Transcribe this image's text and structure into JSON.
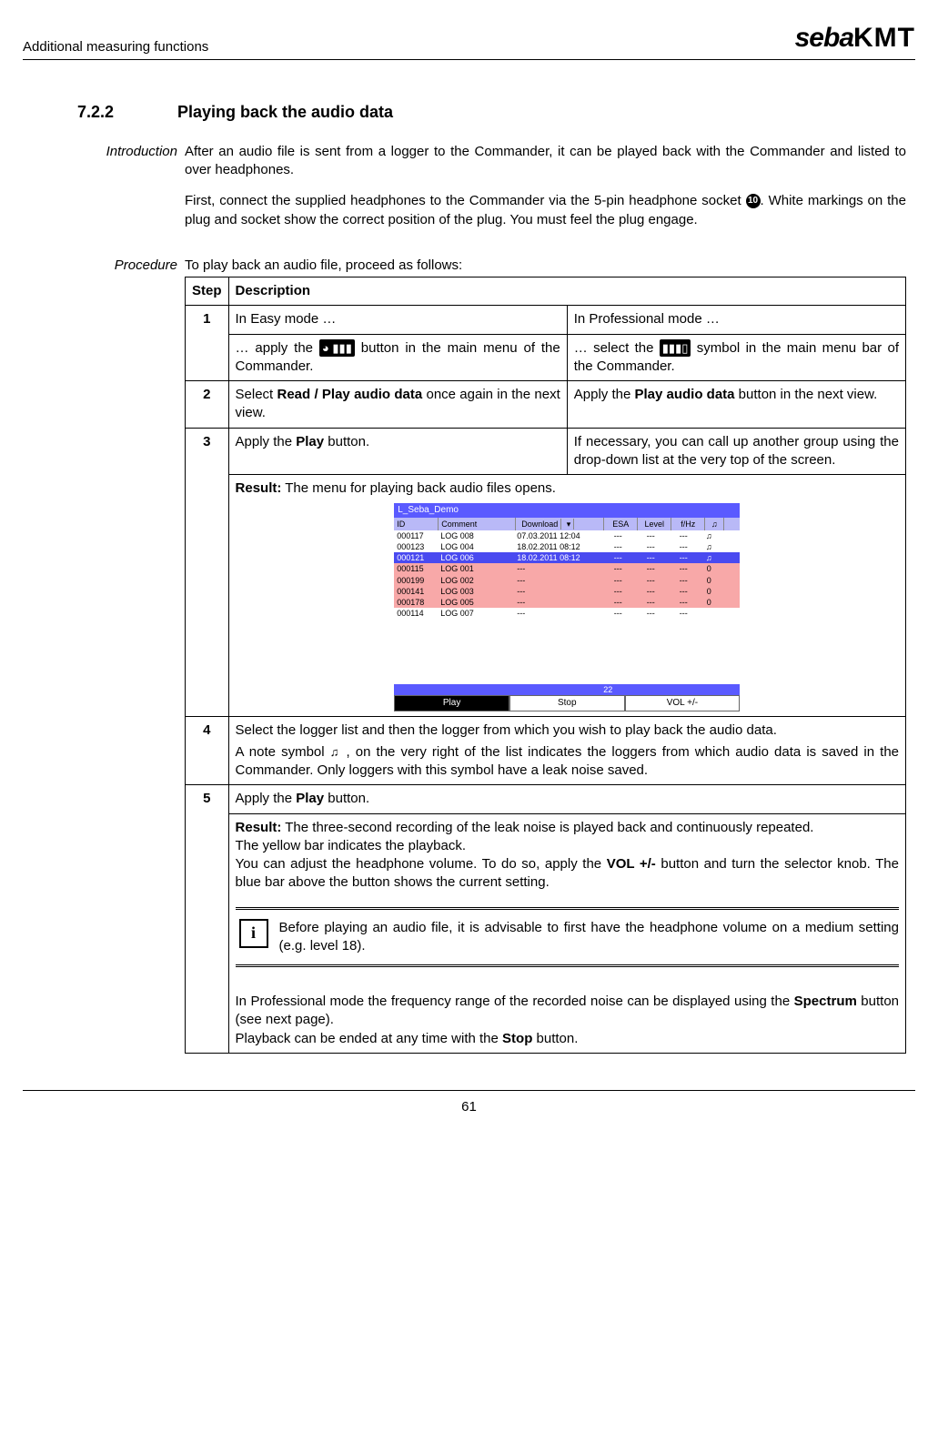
{
  "header": {
    "left": "Additional measuring functions",
    "logo_seba": "seba",
    "logo_kmt": "KMT"
  },
  "section": {
    "number": "7.2.2",
    "title": "Playing back the audio data"
  },
  "labels": {
    "introduction": "Introduction",
    "procedure": "Procedure"
  },
  "intro": {
    "p1": "After an audio file is sent from a logger to the Commander, it can be played back with the Commander and listed to over headphones.",
    "p2a": "First, connect the supplied headphones to the Commander via the 5-pin headphone socket ",
    "p2_badge": "10",
    "p2b": ". White markings on the plug and socket show the correct position of the plug. You must feel the plug engage."
  },
  "procedure": {
    "lead": "To play back an audio file, proceed as follows:",
    "th_step": "Step",
    "th_desc": "Description",
    "row1": {
      "step": "1",
      "easy_head": "In Easy mode …",
      "pro_head": "In Professional mode …",
      "easy_a": "… apply the ",
      "easy_b": " button in the main menu of the Commander.",
      "pro_a": "… select the ",
      "pro_b": " symbol in the main menu bar of the Commander."
    },
    "row2": {
      "step": "2",
      "easy_a": "Select ",
      "easy_bold": "Read / Play audio data",
      "easy_b": " once again in the next view.",
      "pro_a": "Apply the ",
      "pro_bold": "Play audio data",
      "pro_b": " button in the next view."
    },
    "row3": {
      "step": "3",
      "easy_a": "Apply the ",
      "easy_bold": "Play",
      "easy_b": " button.",
      "pro": "If necessary, you can call up another group using the drop-down list at the very top of the screen.",
      "result_label": "Result:",
      "result_text": " The menu for playing back audio files opens."
    },
    "row4": {
      "step": "4",
      "line1": "Select the logger list and then the logger from which you wish to play back the audio data.",
      "line2a": "A note symbol  ",
      "line2b": " , on the very right of the list indicates the loggers from which audio data is saved in the Commander. Only loggers with this symbol have a leak noise saved."
    },
    "row5": {
      "step": "5",
      "line1a": "Apply the ",
      "line1bold": "Play",
      "line1b": " button.",
      "res_label": "Result:",
      "res_text": " The three-second recording of the leak noise is played back and continuously repeated.",
      "res2": "The yellow bar indicates the playback.",
      "res3a": "You can adjust the headphone volume. To do so, apply the ",
      "res3bold": "VOL +/-",
      "res3b": " button and turn the selector knob. The blue bar above the button shows the current setting.",
      "info": "Before playing an audio file, it is advisable to first have the headphone volume on a medium setting (e.g. level 18).",
      "tail1a": "In Professional mode the frequency range of the recorded noise can be displayed using the ",
      "tail1bold": "Spectrum",
      "tail1b": " button (see next page).",
      "tail2a": "Playback can be ended at any time with the ",
      "tail2bold": "Stop",
      "tail2b": " button."
    }
  },
  "screenshot": {
    "title": "L_Seba_Demo",
    "headers": {
      "id": "ID",
      "comment": "Comment",
      "download": "Download",
      "esa": "ESA",
      "level": "Level",
      "fhz": "f/Hz",
      "note": "♫"
    },
    "dropdown": "▾",
    "rows": [
      {
        "id": "000117",
        "cm": "LOG 008",
        "dl": "07.03.2011  12:04",
        "e": "---",
        "l": "---",
        "f": "---",
        "n": "♫",
        "cls": ""
      },
      {
        "id": "000123",
        "cm": "LOG 004",
        "dl": "18.02.2011  08:12",
        "e": "---",
        "l": "---",
        "f": "---",
        "n": "♫",
        "cls": ""
      },
      {
        "id": "000121",
        "cm": "LOG 006",
        "dl": "18.02.2011  08:12",
        "e": "---",
        "l": "---",
        "f": "---",
        "n": "♫",
        "cls": "blue"
      },
      {
        "id": "000115",
        "cm": "LOG 001",
        "dl": "---",
        "e": "---",
        "l": "---",
        "f": "---",
        "n": "0",
        "cls": "pink"
      },
      {
        "id": "000199",
        "cm": "LOG 002",
        "dl": "---",
        "e": "---",
        "l": "---",
        "f": "---",
        "n": "0",
        "cls": "pink"
      },
      {
        "id": "000141",
        "cm": "LOG 003",
        "dl": "---",
        "e": "---",
        "l": "---",
        "f": "---",
        "n": "0",
        "cls": "pink"
      },
      {
        "id": "000178",
        "cm": "LOG 005",
        "dl": "---",
        "e": "---",
        "l": "---",
        "f": "---",
        "n": "0",
        "cls": "pink"
      },
      {
        "id": "000114",
        "cm": "LOG 007",
        "dl": "---",
        "e": "---",
        "l": "---",
        "f": "---",
        "n": "",
        "cls": ""
      }
    ],
    "bar_value": "22",
    "btn_play": "Play",
    "btn_stop": "Stop",
    "btn_vol": "VOL +/-"
  },
  "icons": {
    "easy_btn": "◕ ▮▮▮",
    "pro_btn": "▮▮▮▯",
    "note": "♫"
  },
  "page_number": "61"
}
